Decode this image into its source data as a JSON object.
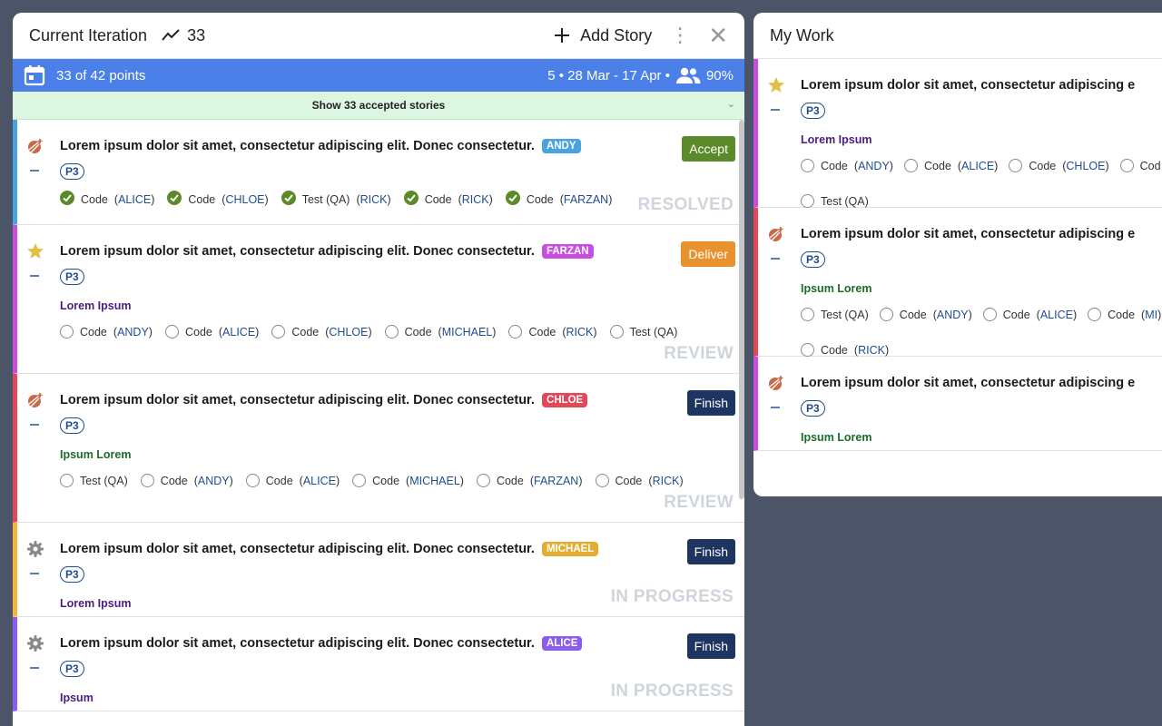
{
  "colors": {
    "background": "#4b5567",
    "info_bar": "#4a80e8",
    "accepted_bar": "#dcf6e2",
    "epic_purple": "#4b1e7d",
    "epic_green": "#1c6b2a",
    "owner_link": "#1f4c8f"
  },
  "left": {
    "title": "Current Iteration",
    "velocity": "33",
    "add_story": "Add Story",
    "info": {
      "points": "33 of 42 points",
      "iteration": "5 • 28 Mar - 17 Apr •",
      "team": "90%"
    },
    "accepted": "Show 33 accepted stories",
    "stories": [
      {
        "icon": "bug-icon",
        "stripe": "#4aa3df",
        "title": "Lorem ipsum dolor sit amet, consectetur adipiscing elit. Donec consectetur.",
        "label": "ANDY",
        "label_color": "#4aa3df",
        "priority": "P3",
        "epic": "",
        "action": "Accept",
        "action_color": "#5b8a2a",
        "state": "RESOLVED",
        "tasks": [
          {
            "done": true,
            "name": "Code",
            "owner": "ALICE"
          },
          {
            "done": true,
            "name": "Code",
            "owner": "CHLOE"
          },
          {
            "done": true,
            "name": "Test (QA)",
            "owner": "RICK"
          },
          {
            "done": true,
            "name": "Code",
            "owner": "RICK"
          },
          {
            "done": true,
            "name": "Code",
            "owner": "FARZAN"
          }
        ]
      },
      {
        "icon": "star-icon",
        "stripe": "#c84ee0",
        "title": "Lorem ipsum dolor sit amet, consectetur adipiscing elit. Donec consectetur.",
        "label": "FARZAN",
        "label_color": "#c84ee0",
        "priority": "P3",
        "epic": "Lorem Ipsum",
        "epic_color": "#4b1e7d",
        "action": "Deliver",
        "action_color": "#e8922f",
        "state": "REVIEW",
        "tasks": [
          {
            "done": false,
            "name": "Code",
            "owner": "ANDY"
          },
          {
            "done": false,
            "name": "Code",
            "owner": "ALICE"
          },
          {
            "done": false,
            "name": "Code",
            "owner": "CHLOE"
          },
          {
            "done": false,
            "name": "Code",
            "owner": "MICHAEL"
          },
          {
            "done": false,
            "name": "Code",
            "owner": "RICK"
          },
          {
            "done": false,
            "name": "Test (QA)",
            "owner": ""
          }
        ]
      },
      {
        "icon": "bug-icon",
        "stripe": "#e2475a",
        "title": "Lorem ipsum dolor sit amet, consectetur adipiscing elit. Donec consectetur.",
        "label": "CHLOE",
        "label_color": "#e2475a",
        "priority": "P3",
        "epic": "Ipsum Lorem",
        "epic_color": "#1c6b2a",
        "action": "Finish",
        "action_color": "#1d3560",
        "state": "REVIEW",
        "tasks": [
          {
            "done": false,
            "name": "Test (QA)",
            "owner": ""
          },
          {
            "done": false,
            "name": "Code",
            "owner": "ANDY"
          },
          {
            "done": false,
            "name": "Code",
            "owner": "ALICE"
          },
          {
            "done": false,
            "name": "Code",
            "owner": "MICHAEL"
          },
          {
            "done": false,
            "name": "Code",
            "owner": "FARZAN"
          },
          {
            "done": false,
            "name": "Code",
            "owner": "RICK"
          }
        ]
      },
      {
        "icon": "gear-icon",
        "stripe": "#f0b93c",
        "title": "Lorem ipsum dolor sit amet, consectetur adipiscing elit. Donec consectetur.",
        "label": "MICHAEL",
        "label_color": "#e4ad2e",
        "priority": "P3",
        "epic": "Lorem Ipsum",
        "epic_color": "#4b1e7d",
        "action": "Finish",
        "action_color": "#1d3560",
        "state": "IN PROGRESS",
        "tasks": []
      },
      {
        "icon": "gear-icon",
        "stripe": "#8b5cf0",
        "title": "Lorem ipsum dolor sit amet, consectetur adipiscing elit. Donec consectetur.",
        "label": "ALICE",
        "label_color": "#8b5cf0",
        "priority": "P3",
        "epic": "Ipsum",
        "epic_color": "#4b1e7d",
        "action": "Finish",
        "action_color": "#1d3560",
        "state": "IN PROGRESS",
        "tasks": []
      }
    ]
  },
  "right": {
    "title": "My Work",
    "stories": [
      {
        "icon": "star-icon",
        "stripe": "#c84ee0",
        "title": "Lorem ipsum dolor sit amet, consectetur adipiscing e",
        "priority": "P3",
        "epic": "Lorem Ipsum",
        "epic_color": "#4b1e7d",
        "tasks": [
          {
            "done": false,
            "name": "Code",
            "owner": "ANDY"
          },
          {
            "done": false,
            "name": "Code",
            "owner": "ALICE"
          },
          {
            "done": false,
            "name": "Code",
            "owner": "CHLOE"
          },
          {
            "done": false,
            "name": "Cod",
            "owner": ""
          },
          {
            "done": false,
            "name": "Test (QA)",
            "owner": ""
          }
        ]
      },
      {
        "icon": "bug-icon",
        "stripe": "#e2475a",
        "title": "Lorem ipsum dolor sit amet, consectetur adipiscing e",
        "priority": "P3",
        "epic": "Ipsum Lorem",
        "epic_color": "#1c6b2a",
        "tasks": [
          {
            "done": false,
            "name": "Test (QA)",
            "owner": ""
          },
          {
            "done": false,
            "name": "Code",
            "owner": "ANDY"
          },
          {
            "done": false,
            "name": "Code",
            "owner": "ALICE"
          },
          {
            "done": false,
            "name": "Code",
            "owner": "MI"
          },
          {
            "done": false,
            "name": "Code",
            "owner": "RICK"
          }
        ]
      },
      {
        "icon": "bug-icon",
        "stripe": "#c84ee0",
        "title": "Lorem ipsum dolor sit amet, consectetur adipiscing e",
        "priority": "P3",
        "epic": "Ipsum Lorem",
        "epic_color": "#1c6b2a",
        "tasks": []
      }
    ]
  }
}
